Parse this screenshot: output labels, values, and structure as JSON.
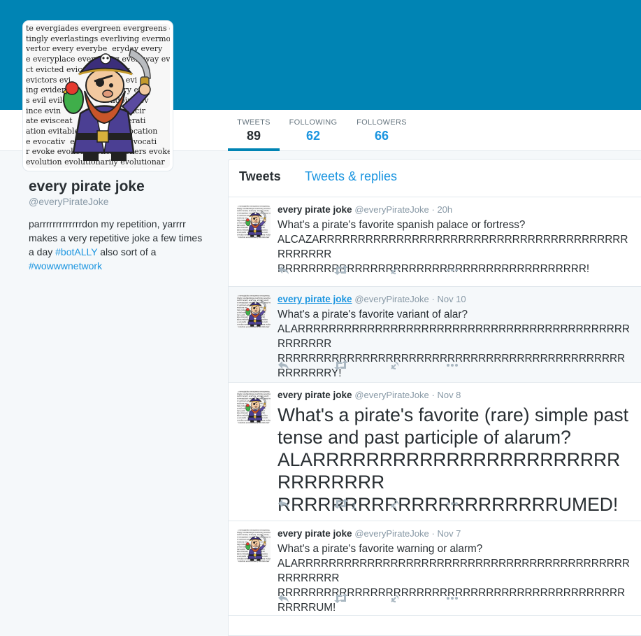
{
  "theme": {
    "accent": "#0084b4",
    "link": "#1b95e0"
  },
  "profile": {
    "name": "every pirate joke",
    "handle": "@everyPirateJoke",
    "bio_text1": "parrrrrrrrrrrrrdon my repetition, yarrrr makes a very repetitive joke a few times a day ",
    "bio_link1": "#botALLY",
    "bio_text2": " also sort of a ",
    "bio_link2": "#wowwwnetwork",
    "avatar_words": [
      "te evergiades evergreen evergreens e",
      "tingly everlastings everliving evermo",
      "vertor every everybe  eryday every",
      "e everyplace everything everyway ev",
      "ct evicted evic       ction ev",
      "evictors evi            enced evi",
      "ing evident              entiary ev",
      "s evil evild              evildoing ev",
      "ince evin               cible evincir",
      "ate evisceat          es eviscerati",
      "ation evitable         able evocation",
      "e evocativ  ecatt      eness evocati",
      "r evoke evoked evoker evokers evokes",
      "evolution evolutionarily evolutionar"
    ]
  },
  "stats": {
    "tweets_label": "TWEETS",
    "tweets_value": "89",
    "following_label": "FOLLOWING",
    "following_value": "62",
    "followers_label": "FOLLOWERS",
    "followers_value": "66"
  },
  "tabs": {
    "tweets": "Tweets",
    "replies": "Tweets & replies"
  },
  "tweets": [
    {
      "name": "every pirate joke",
      "handle": "@everyPirateJoke",
      "time": "· 20h",
      "line1": "What's a pirate's favorite spanish palace or fortress?",
      "line2": "ALCAZARRRRRRRRRRRRRRRRRRRRRRRRRRRRRRRRRRRRRRRRRRRRRRR",
      "line3": "RRRRRRRRRRRRRRRRRRRRRRRRRRRRRRRRRRRRRRRR!"
    },
    {
      "name": "every pirate joke",
      "handle": "@everyPirateJoke",
      "time": "· Nov 10",
      "line1": "What's a pirate's favorite variant of alar?",
      "line2": "ALARRRRRRRRRRRRRRRRRRRRRRRRRRRRRRRRRRRRRRRRRRRRRRRRRR",
      "line3": "RRRRRRRRRRRRRRRRRRRRRRRRRRRRRRRRRRRRRRRRRRRRRRRRRRRRY!"
    },
    {
      "name": "every pirate joke",
      "handle": "@everyPirateJoke",
      "time": "· Nov 8",
      "line1": "What's a pirate's favorite (rare) simple past",
      "line2": "tense and past participle of alarum?",
      "line3": "ALARRRRRRRRRRRRRRRRRRRRRRRRRRRRRRR",
      "line4": "RRRRRRRRRRRRRRRRRRRRRUMED!",
      "retweets": "1"
    },
    {
      "name": "every pirate joke",
      "handle": "@everyPirateJoke",
      "time": "· Nov 7",
      "line1": "What's a pirate's favorite warning or alarm?",
      "line2": "ALARRRRRRRRRRRRRRRRRRRRRRRRRRRRRRRRRRRRRRRRRRRRRRRRRRR",
      "line3": "RRRRRRRRRRRRRRRRRRRRRRRRRRRRRRRRRRRRRRRRRRRRRRRRRRUM!"
    }
  ],
  "icons": {
    "reply": "reply-icon",
    "retweet": "retweet-icon",
    "favorite": "favorite-icon",
    "more": "more-icon"
  }
}
